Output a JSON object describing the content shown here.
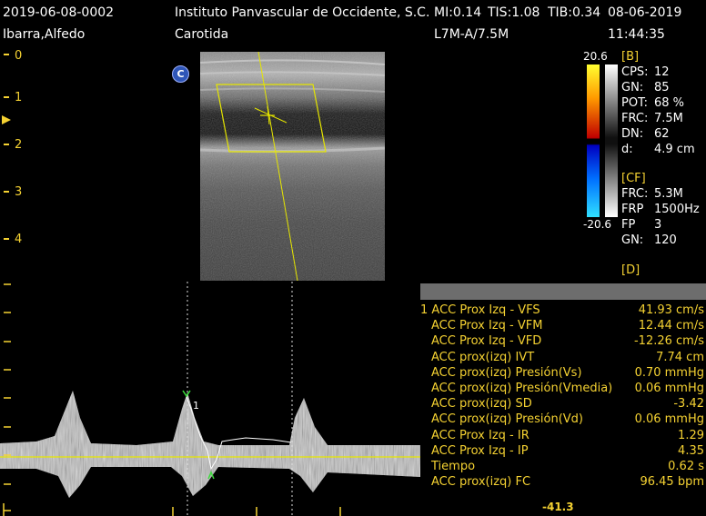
{
  "header": {
    "study_id": "2019-06-08-0002",
    "institution": "Instituto Panvascular de Occidente, S.C.",
    "mi": "MI:0.14",
    "tis": "TIS:1.08",
    "tib": "TIB:0.34",
    "date": "08-06-2019",
    "patient": "Ibarra,Alfedo",
    "exam": "Carotida",
    "probe": "L7M-A/7.5M",
    "time": "11:44:35"
  },
  "depth_scale": [
    "0",
    "1",
    "2",
    "3",
    "4"
  ],
  "mode_icon": "C",
  "color_scale": {
    "max": "20.6",
    "min": "-20.6"
  },
  "params": {
    "b_section": "[B]",
    "b_rows": [
      {
        "k": "CPS:",
        "v": "12"
      },
      {
        "k": "GN:",
        "v": "85"
      },
      {
        "k": "POT:",
        "v": "68 %"
      },
      {
        "k": "FRC:",
        "v": "7.5M"
      },
      {
        "k": "DN:",
        "v": "62"
      },
      {
        "k": "d:",
        "v": "4.9 cm"
      }
    ],
    "cf_section": "[CF]",
    "cf_rows": [
      {
        "k": "FRC:",
        "v": "5.3M"
      },
      {
        "k": "FRP",
        "v": "1500Hz"
      },
      {
        "k": "FP",
        "v": "3"
      },
      {
        "k": "GN:",
        "v": "120"
      }
    ],
    "d_section": "[D]"
  },
  "measurements": [
    {
      "label": "1 ACC Prox Izq - VFS",
      "value": "41.93 cm/s"
    },
    {
      "label": "ACC Prox Izq - VFM",
      "value": "12.44 cm/s"
    },
    {
      "label": "ACC Prox Izq - VFD",
      "value": "-12.26 cm/s"
    },
    {
      "label": "ACC prox(izq) IVT",
      "value": "7.74 cm"
    },
    {
      "label": "ACC prox(izq) Presión(Vs)",
      "value": "0.70 mmHg"
    },
    {
      "label": "ACC prox(izq) Presión(Vmedia)",
      "value": "0.06 mmHg"
    },
    {
      "label": "ACC prox(izq) SD",
      "value": "-3.42"
    },
    {
      "label": "ACC prox(izq) Presión(Vd)",
      "value": "0.06 mmHg"
    },
    {
      "label": "ACC Prox Izq - IR",
      "value": "1.29"
    },
    {
      "label": "ACC Prox Izq - IP",
      "value": "4.35"
    },
    {
      "label": "Tiempo",
      "value": "0.62 s"
    },
    {
      "label": "ACC prox(izq) FC",
      "value": "96.45 bpm"
    }
  ],
  "doppler": {
    "scale_min_label": "-41.3",
    "caliper_label": "1"
  },
  "colors": {
    "accent_yellow": "#f5d232",
    "overlay_yellow": "#e6e600",
    "caliper_green": "#3ddc3d",
    "panel_gray": "#6d6d6d"
  }
}
